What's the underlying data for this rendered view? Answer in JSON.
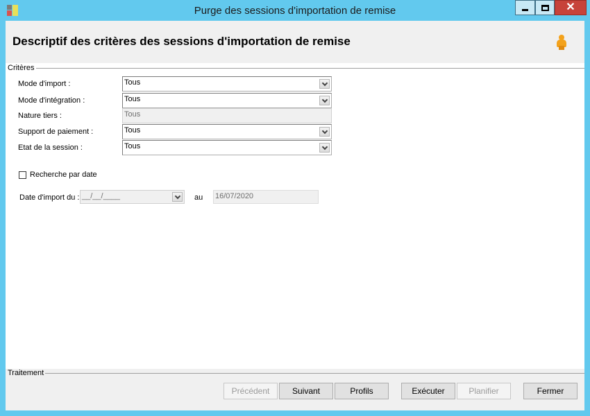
{
  "window": {
    "title": "Purge des sessions d'importation de remise",
    "close_glyph": "✕"
  },
  "header": {
    "title": "Descriptif des critères des sessions d'importation de remise",
    "user_icon": "user-icon"
  },
  "criteres": {
    "group_label": "Critères",
    "fields": [
      {
        "label": "Mode d'import :",
        "value": "Tous",
        "enabled": true
      },
      {
        "label": "Mode d'intégration :",
        "value": "Tous",
        "enabled": true
      },
      {
        "label": "Nature tiers :",
        "value": "Tous",
        "enabled": false
      },
      {
        "label": "Support de paiement :",
        "value": "Tous",
        "enabled": true
      },
      {
        "label": "Etat de la session :",
        "value": "Tous",
        "enabled": true
      }
    ],
    "date_search": {
      "checkbox_label": "Recherche par date",
      "checked": false,
      "from_label": "Date d'import du :",
      "from_value": "__/__/____",
      "to_label": "au",
      "to_value": "16/07/2020"
    }
  },
  "traitement": {
    "group_label": "Traitement",
    "buttons": {
      "precedent": "Précédent",
      "suivant": "Suivant",
      "profils": "Profils",
      "executer": "Exécuter",
      "planifier": "Planifier",
      "fermer": "Fermer"
    }
  }
}
